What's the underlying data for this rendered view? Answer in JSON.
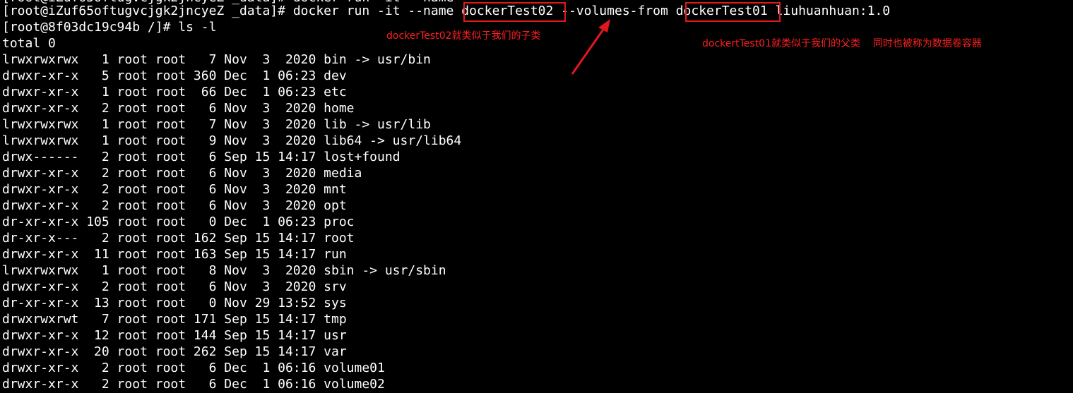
{
  "terminal": {
    "cut_line": "[root@iZuf65oftugvcjgk2jncyeZ _data]# docker run -it --name",
    "command_line": {
      "prompt": "[root@iZuf65oftugvcjgk2jncyeZ _data]#",
      "command": "docker run -it --name",
      "name_arg": "dockerTest02",
      "volumes_flag": "--volumes-from",
      "volumes_arg": "dockerTest01",
      "image": "liuhuanhuan:1.0"
    },
    "lines": [
      "[root@8f03dc19c94b /]# ls -l",
      "total 0",
      "lrwxrwxrwx   1 root root   7 Nov  3  2020 bin -> usr/bin",
      "drwxr-xr-x   5 root root 360 Dec  1 06:23 dev",
      "drwxr-xr-x   1 root root  66 Dec  1 06:23 etc",
      "drwxr-xr-x   2 root root   6 Nov  3  2020 home",
      "lrwxrwxrwx   1 root root   7 Nov  3  2020 lib -> usr/lib",
      "lrwxrwxrwx   1 root root   9 Nov  3  2020 lib64 -> usr/lib64",
      "drwx------   2 root root   6 Sep 15 14:17 lost+found",
      "drwxr-xr-x   2 root root   6 Nov  3  2020 media",
      "drwxr-xr-x   2 root root   6 Nov  3  2020 mnt",
      "drwxr-xr-x   2 root root   6 Nov  3  2020 opt",
      "dr-xr-xr-x 105 root root   0 Dec  1 06:23 proc",
      "dr-xr-x---   2 root root 162 Sep 15 14:17 root",
      "drwxr-xr-x  11 root root 163 Sep 15 14:17 run",
      "lrwxrwxrwx   1 root root   8 Nov  3  2020 sbin -> usr/sbin",
      "drwxr-xr-x   2 root root   6 Nov  3  2020 srv",
      "dr-xr-xr-x  13 root root   0 Nov 29 13:52 sys",
      "drwxrwxrwt   7 root root 171 Sep 15 14:17 tmp",
      "drwxr-xr-x  12 root root 144 Sep 15 14:17 usr",
      "drwxr-xr-x  20 root root 262 Sep 15 14:17 var",
      "drwxr-xr-x   2 root root   6 Dec  1 06:16 volume01",
      "drwxr-xr-x   2 root root   6 Dec  1 06:16 volume02"
    ]
  },
  "annotations": {
    "child_note": "dockerTest02就类似于我们的子类",
    "parent_note": "dockertTest01就类似于我们的父类    同时也被称为数据卷容器"
  },
  "colors": {
    "background": "#000000",
    "text": "#ffffff",
    "annotation": "#ff1f1f",
    "highlight_box": "#e0181e"
  }
}
